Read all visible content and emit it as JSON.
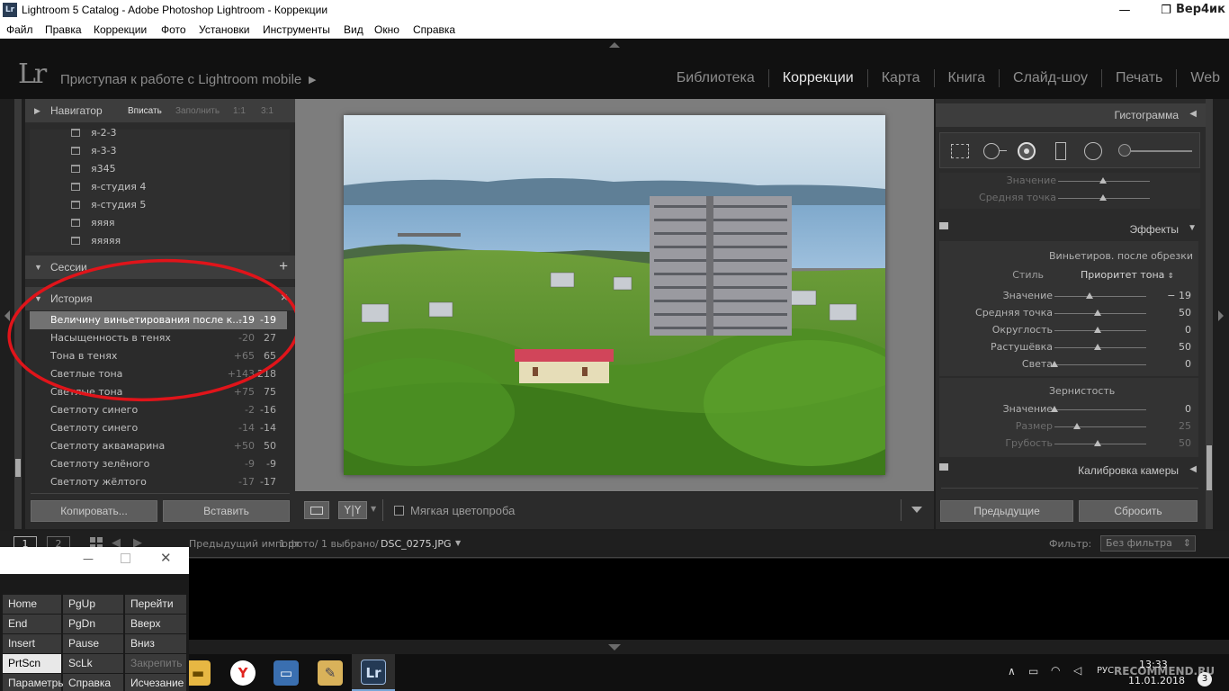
{
  "window": {
    "app_icon": "Lr",
    "title": "Lightroom 5 Catalog - Adobe Photoshop Lightroom - Коррекции",
    "minimize": "—",
    "maximize": "❐",
    "user_watermark": "Вер4ик"
  },
  "menu": [
    "Файл",
    "Правка",
    "Коррекции",
    "Фото",
    "Установки",
    "Инструменты",
    "Вид",
    "Окно",
    "Справка"
  ],
  "identity": {
    "logo": "Lr",
    "mobile_text": "Приступая к работе с Lightroom mobile",
    "modules": [
      "Библиотека",
      "Коррекции",
      "Карта",
      "Книга",
      "Слайд-шоу",
      "Печать",
      "Web"
    ],
    "active_module": "Коррекции"
  },
  "left": {
    "navigator": {
      "title": "Навигатор",
      "options": [
        "Вписать",
        "Заполнить",
        "1:1",
        "3:1"
      ],
      "selected": "Вписать"
    },
    "collections": [
      "я-2-3",
      "я-3-3",
      "я345",
      "я-студия 4",
      "я-студия 5",
      "яяяя",
      "яяяяя"
    ],
    "sessions_title": "Сессии",
    "history_title": "История",
    "history": [
      {
        "name": "Величину виньетирования после к...",
        "from": "-19",
        "to": "-19"
      },
      {
        "name": "Насыщенность в тенях",
        "from": "-20",
        "to": "27"
      },
      {
        "name": "Тона в тенях",
        "from": "+65",
        "to": "65"
      },
      {
        "name": "Светлые тона",
        "from": "+143",
        "to": "218"
      },
      {
        "name": "Светлые тона",
        "from": "+75",
        "to": "75"
      },
      {
        "name": "Светлоту синего",
        "from": "-2",
        "to": "-16"
      },
      {
        "name": "Светлоту синего",
        "from": "-14",
        "to": "-14"
      },
      {
        "name": "Светлоту аквамарина",
        "from": "+50",
        "to": "50"
      },
      {
        "name": "Светлоту зелёного",
        "from": "-9",
        "to": "-9"
      },
      {
        "name": "Светлоту жёлтого",
        "from": "-17",
        "to": "-17"
      }
    ],
    "copy_button": "Копировать...",
    "paste_button": "Вставить"
  },
  "toolbar": {
    "soft_proof": "Мягкая цветопроба"
  },
  "right": {
    "histogram_title": "Гистограмма",
    "top_partial": [
      {
        "label": "Значение",
        "pos": 0.6
      },
      {
        "label": "Средняя точка",
        "pos": 0.6
      }
    ],
    "effects_title": "Эффекты",
    "vignette_title": "Виньетиров. после обрезки",
    "style_label": "Стиль",
    "style_value": "Приоритет тона",
    "vignette": [
      {
        "label": "Значение",
        "value": "− 19",
        "pos": 0.42
      },
      {
        "label": "Средняя точка",
        "value": "50",
        "pos": 0.5
      },
      {
        "label": "Округлость",
        "value": "0",
        "pos": 0.5
      },
      {
        "label": "Растушёвка",
        "value": "50",
        "pos": 0.5
      },
      {
        "label": "Света",
        "value": "0",
        "pos": 0.0
      }
    ],
    "grain_title": "Зернистость",
    "grain": [
      {
        "label": "Значение",
        "value": "0",
        "pos": 0.0
      },
      {
        "label": "Размер",
        "value": "25",
        "pos": 0.25
      },
      {
        "label": "Грубость",
        "value": "50",
        "pos": 0.5
      }
    ],
    "calibration_title": "Калибровка камеры",
    "prev_button": "Предыдущие",
    "reset_button": "Сбросить"
  },
  "filmbar": {
    "page1": "1",
    "page2": "2",
    "source": "Предыдущий импорт",
    "count": "1 фото/ 1 выбрано/",
    "filename": "DSC_0275.JPG",
    "filter_label": "Фильтр:",
    "filter_value": "Без фильтра"
  },
  "osk": {
    "keys": [
      [
        "Home",
        "PgUp",
        "Перейти"
      ],
      [
        "End",
        "PgDn",
        "Вверх"
      ],
      [
        "Insert",
        "Pause",
        "Вниз"
      ],
      [
        "PrtScn",
        "ScLk",
        "Закрепить"
      ],
      [
        "Параметры",
        "Справка",
        "Исчезание"
      ]
    ]
  },
  "taskbar": {
    "lang": "РУС",
    "time": "13:33",
    "date": "11.01.2018",
    "watermark": "RECOMMEND.RU",
    "notify": "3"
  }
}
